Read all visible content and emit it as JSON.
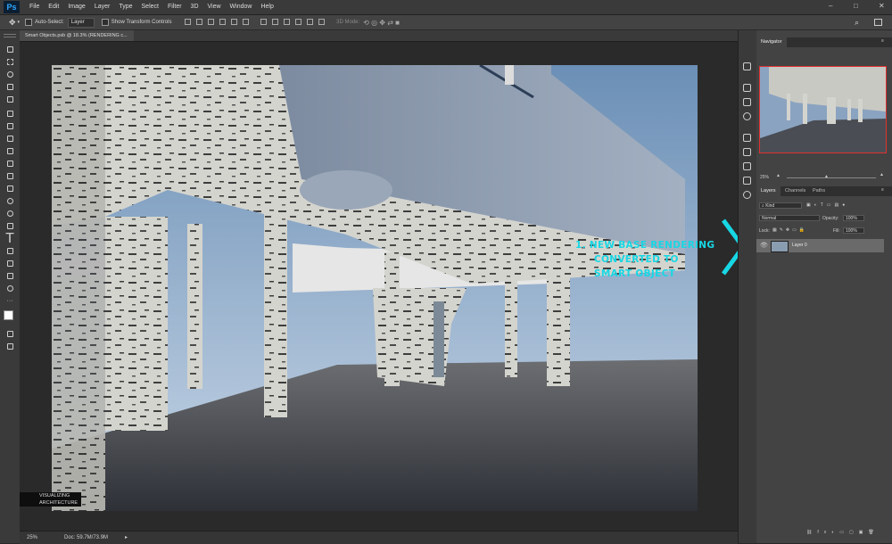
{
  "app": {
    "logo": "Ps"
  },
  "menu": [
    "File",
    "Edit",
    "Image",
    "Layer",
    "Type",
    "Select",
    "Filter",
    "3D",
    "View",
    "Window",
    "Help"
  ],
  "options_bar": {
    "auto_select_label": "Auto-Select:",
    "auto_select_value": "Layer",
    "transform_label": "Show Transform Controls",
    "mode_3d_label": "3D Mode:"
  },
  "document": {
    "tab_title": "Smart Objects.psb @ 18.3% (RENDERING c..."
  },
  "annotation": {
    "line1": "1.  NEW BASE RENDERING",
    "line2": "CONVERTED TO",
    "line3": "SMART OBJECT",
    "color": "#17d7e4"
  },
  "status": {
    "zoom": "25%",
    "doc_size": "Doc: 59.7M/73.9M"
  },
  "watermark": {
    "line1": "VISUALIZING",
    "line2": "ARCHITECTURE"
  },
  "navigator": {
    "tab": "Navigator",
    "zoom": "25%"
  },
  "layers_panel": {
    "tabs": [
      "Layers",
      "Channels",
      "Paths"
    ],
    "filter_kind": "Kind",
    "blend_mode": "Normal",
    "opacity_label": "Opacity:",
    "opacity_value": "100%",
    "lock_label": "Lock:",
    "fill_label": "Fill:",
    "fill_value": "100%",
    "layer_name": "Layer 0"
  },
  "colors": {
    "accent": "#17d7e4",
    "nav_frame": "#e03030"
  },
  "icons": [
    "move-icon",
    "marquee-icon",
    "lasso-icon",
    "quick-select-icon",
    "crop-icon",
    "eyedropper-icon",
    "healing-icon",
    "brush-icon",
    "stamp-icon",
    "history-brush-icon",
    "eraser-icon",
    "gradient-icon",
    "blur-icon",
    "dodge-icon",
    "pen-icon",
    "type-icon",
    "path-select-icon",
    "rectangle-icon",
    "hand-icon",
    "zoom-icon",
    "more-icon",
    "colors-icon",
    "quickmask-icon",
    "screen-mode-icon"
  ]
}
